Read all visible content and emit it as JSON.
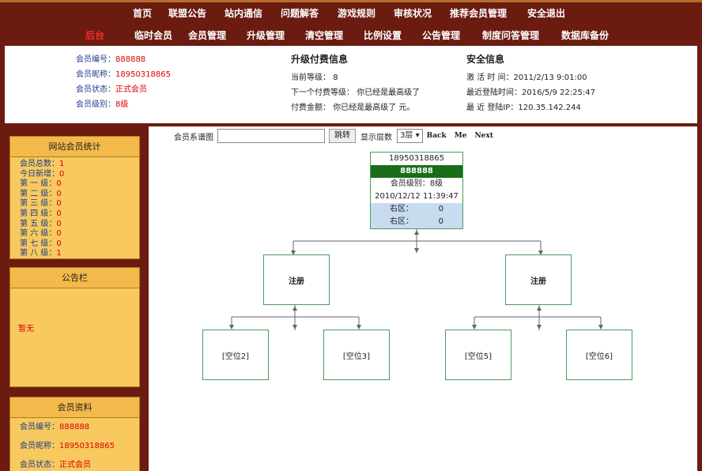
{
  "header": {
    "nav_top": [
      "首页",
      "联盟公告",
      "站内通信",
      "问题解答",
      "游戏规则",
      "审核状况",
      "推荐会员管理",
      "安全退出"
    ],
    "nav_admin": [
      "后台",
      "临时会员",
      "会员管理",
      "升级管理",
      "清空管理",
      "比例设置",
      "公告管理",
      "制度问答管理",
      "数据库备份"
    ]
  },
  "info": {
    "member": {
      "id_label": "会员编号：",
      "id": "888888",
      "nick_label": "会员昵称：",
      "nick": "18950318865",
      "status_label": "会员状态：",
      "status": "正式会员",
      "level_label": "会员级别：",
      "level": "8级"
    },
    "upgrade": {
      "title": "升级付费信息",
      "current_label": "当前等级：",
      "current": "8",
      "next_label": "下一个付费等级：",
      "next": "你已经是最高级了",
      "fee_label": "付费金额：",
      "fee": "你已经是最高级了 元。"
    },
    "security": {
      "title": "安全信息",
      "activate_label": "激 活 时 间：",
      "activate": "2011/2/13 9:01:00",
      "last_login_label": "最近登陆时间：",
      "last_login": "2016/5/9 22:25:47",
      "last_ip_label": "最 近 登陆IP：",
      "last_ip": "120.35.142.244"
    }
  },
  "sidebar": {
    "stats": {
      "title": "网站会员统计",
      "rows": [
        {
          "label": "会员总数：",
          "value": "1"
        },
        {
          "label": "今日新增：",
          "value": "0"
        },
        {
          "label": "第 一 级：",
          "value": "0"
        },
        {
          "label": "第 二 级：",
          "value": "0"
        },
        {
          "label": "第 三 级：",
          "value": "0"
        },
        {
          "label": "第 四 级：",
          "value": "0"
        },
        {
          "label": "第 五 级：",
          "value": "0"
        },
        {
          "label": "第 六 级：",
          "value": "0"
        },
        {
          "label": "第 七 级：",
          "value": "0"
        },
        {
          "label": "第 八 级：",
          "value": "1"
        }
      ]
    },
    "notice": {
      "title": "公告栏",
      "empty": "暂无"
    },
    "profile": {
      "title": "会员资料",
      "rows": [
        {
          "label": "会员编号：",
          "value": "888888"
        },
        {
          "label": "会员昵称：",
          "value": "18950318865"
        },
        {
          "label": "会员状态：",
          "value": "正式会员"
        }
      ]
    }
  },
  "toolbar": {
    "label": "会员系谱图",
    "input_value": "",
    "jump": "跳转",
    "depth_label": "显示层数",
    "depth_value": "3层",
    "back": "Back",
    "me": "Me",
    "next": "Next"
  },
  "tree": {
    "root": {
      "nick": "18950318865",
      "id": "888888",
      "level": "会员级别：8级",
      "time": "2010/12/12 11:39:47",
      "right1_label": "右区：",
      "right1": "0",
      "right2_label": "右区：",
      "right2": "0"
    },
    "left_child": "注册",
    "right_child": "注册",
    "leaves": [
      "[空位2]",
      "[空位3]",
      "[空位5]",
      "[空位6]"
    ]
  }
}
